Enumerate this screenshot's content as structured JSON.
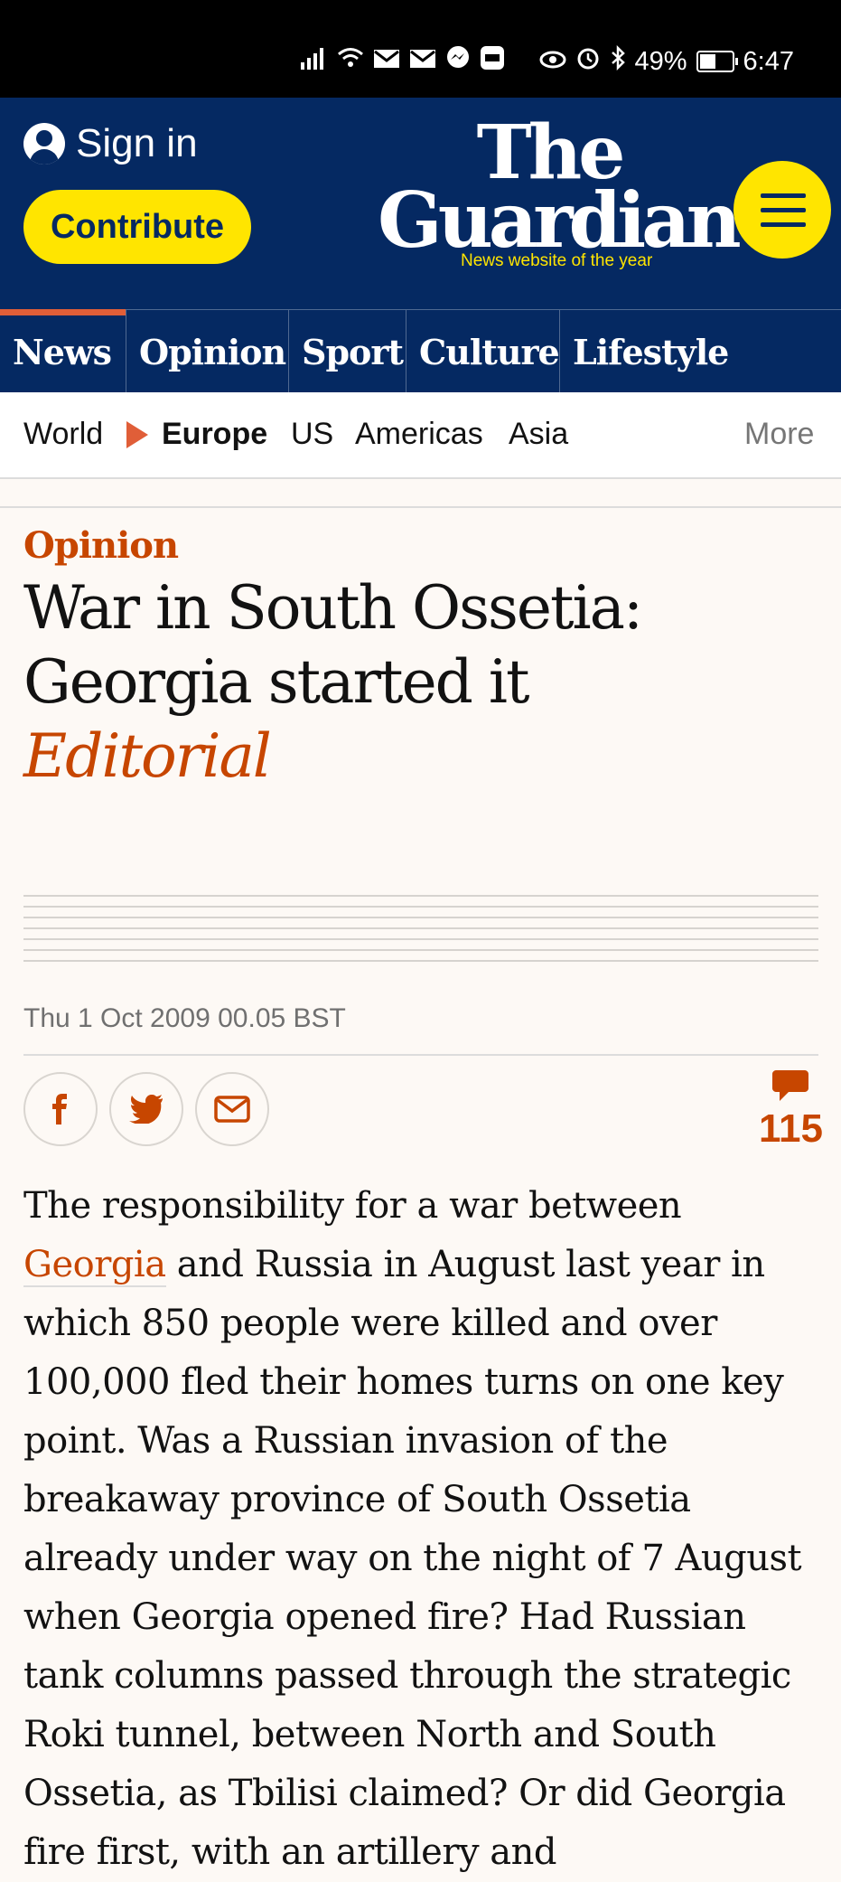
{
  "status_bar": {
    "battery": "49%",
    "time": "6:47",
    "battery_level": 0.49
  },
  "header": {
    "sign_in": "Sign in",
    "contribute": "Contribute",
    "logo_line1": "The",
    "logo_line2": "Guardian",
    "logo_tagline": "News website of the year"
  },
  "pillars": [
    "News",
    "Opinion",
    "Sport",
    "Culture",
    "Lifestyle"
  ],
  "subnav": {
    "world": "World",
    "current": "Europe",
    "us": "US",
    "americas": "Americas",
    "asia": "Asia",
    "more": "More"
  },
  "article": {
    "kicker": "Opinion",
    "headline_line1": "War in South Ossetia:",
    "headline_line2": "Georgia started it",
    "byline": "Editorial",
    "date": "Thu 1 Oct 2009 00.05 BST",
    "comment_count": "115",
    "body_link": "Georgia",
    "body_before": "The responsibility for a war between ",
    "body_after": " and Russia in August last year in which 850 people were killed and over 100,000 fled their homes turns on one key point. Was a Russian invasion of the breakaway province of South Ossetia already under way on the night of 7 August when Georgia opened fire? Had Russian tank columns passed through the strategic Roki tunnel, between North and South Ossetia, as Tbilisi claimed? Or did Georgia fire first, with an artillery and"
  },
  "colors": {
    "brand_blue": "#052962",
    "yellow": "#ffe500",
    "opinion_orange": "#c74600",
    "news_red": "#e05e38"
  },
  "icons": [
    "signal-icon",
    "wifi-icon",
    "mail-icon",
    "messenger-icon",
    "eye-icon",
    "alarm-icon",
    "bluetooth-icon",
    "battery-icon",
    "user-icon",
    "menu-icon",
    "facebook-icon",
    "twitter-icon",
    "email-icon",
    "comment-icon"
  ]
}
